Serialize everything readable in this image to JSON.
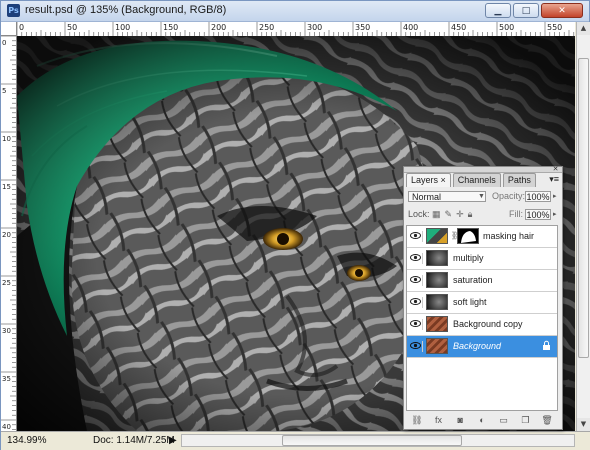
{
  "window": {
    "title": "result.psd @ 135% (Background, RGB/8)",
    "app_badge": "Ps",
    "buttons": [
      "minimize",
      "maximize",
      "close"
    ]
  },
  "ruler": {
    "top_labels": [
      "0",
      "50",
      "100",
      "150",
      "200",
      "250",
      "300",
      "350",
      "400",
      "450",
      "500",
      "550"
    ],
    "left_labels": [
      "0",
      "5",
      "1 0",
      "1 5",
      "2 0",
      "2 5",
      "3 0",
      "3 5",
      "4 0"
    ]
  },
  "status": {
    "zoom": "134.99%",
    "doc": "Doc: 1.14M/7.25M",
    "arrow": "▶"
  },
  "layers_panel": {
    "tabs": [
      {
        "label": "Layers ×",
        "active": true
      },
      {
        "label": "Channels",
        "active": false
      },
      {
        "label": "Paths",
        "active": false
      }
    ],
    "menu_glyph": "▾≡",
    "blend_mode": "Normal",
    "opacity_label": "Opacity:",
    "opacity": "100%",
    "lock_label": "Lock:",
    "fill_label": "Fill:",
    "fill": "100%",
    "layers": [
      {
        "name": "masking hair",
        "thumb": "color",
        "has_mask": true,
        "selected": false,
        "locked": false
      },
      {
        "name": "multiply",
        "thumb": "gray",
        "has_mask": false,
        "selected": false,
        "locked": false
      },
      {
        "name": "saturation",
        "thumb": "gray",
        "has_mask": false,
        "selected": false,
        "locked": false
      },
      {
        "name": "soft light",
        "thumb": "gray",
        "has_mask": false,
        "selected": false,
        "locked": false
      },
      {
        "name": "Background copy",
        "thumb": "texture",
        "has_mask": false,
        "selected": false,
        "locked": false
      },
      {
        "name": "Background",
        "thumb": "texture",
        "has_mask": false,
        "selected": true,
        "locked": true
      }
    ]
  },
  "colors": {
    "hair": "#1fae7c",
    "eye": "#d7a028",
    "selection": "#3b8fe0"
  }
}
